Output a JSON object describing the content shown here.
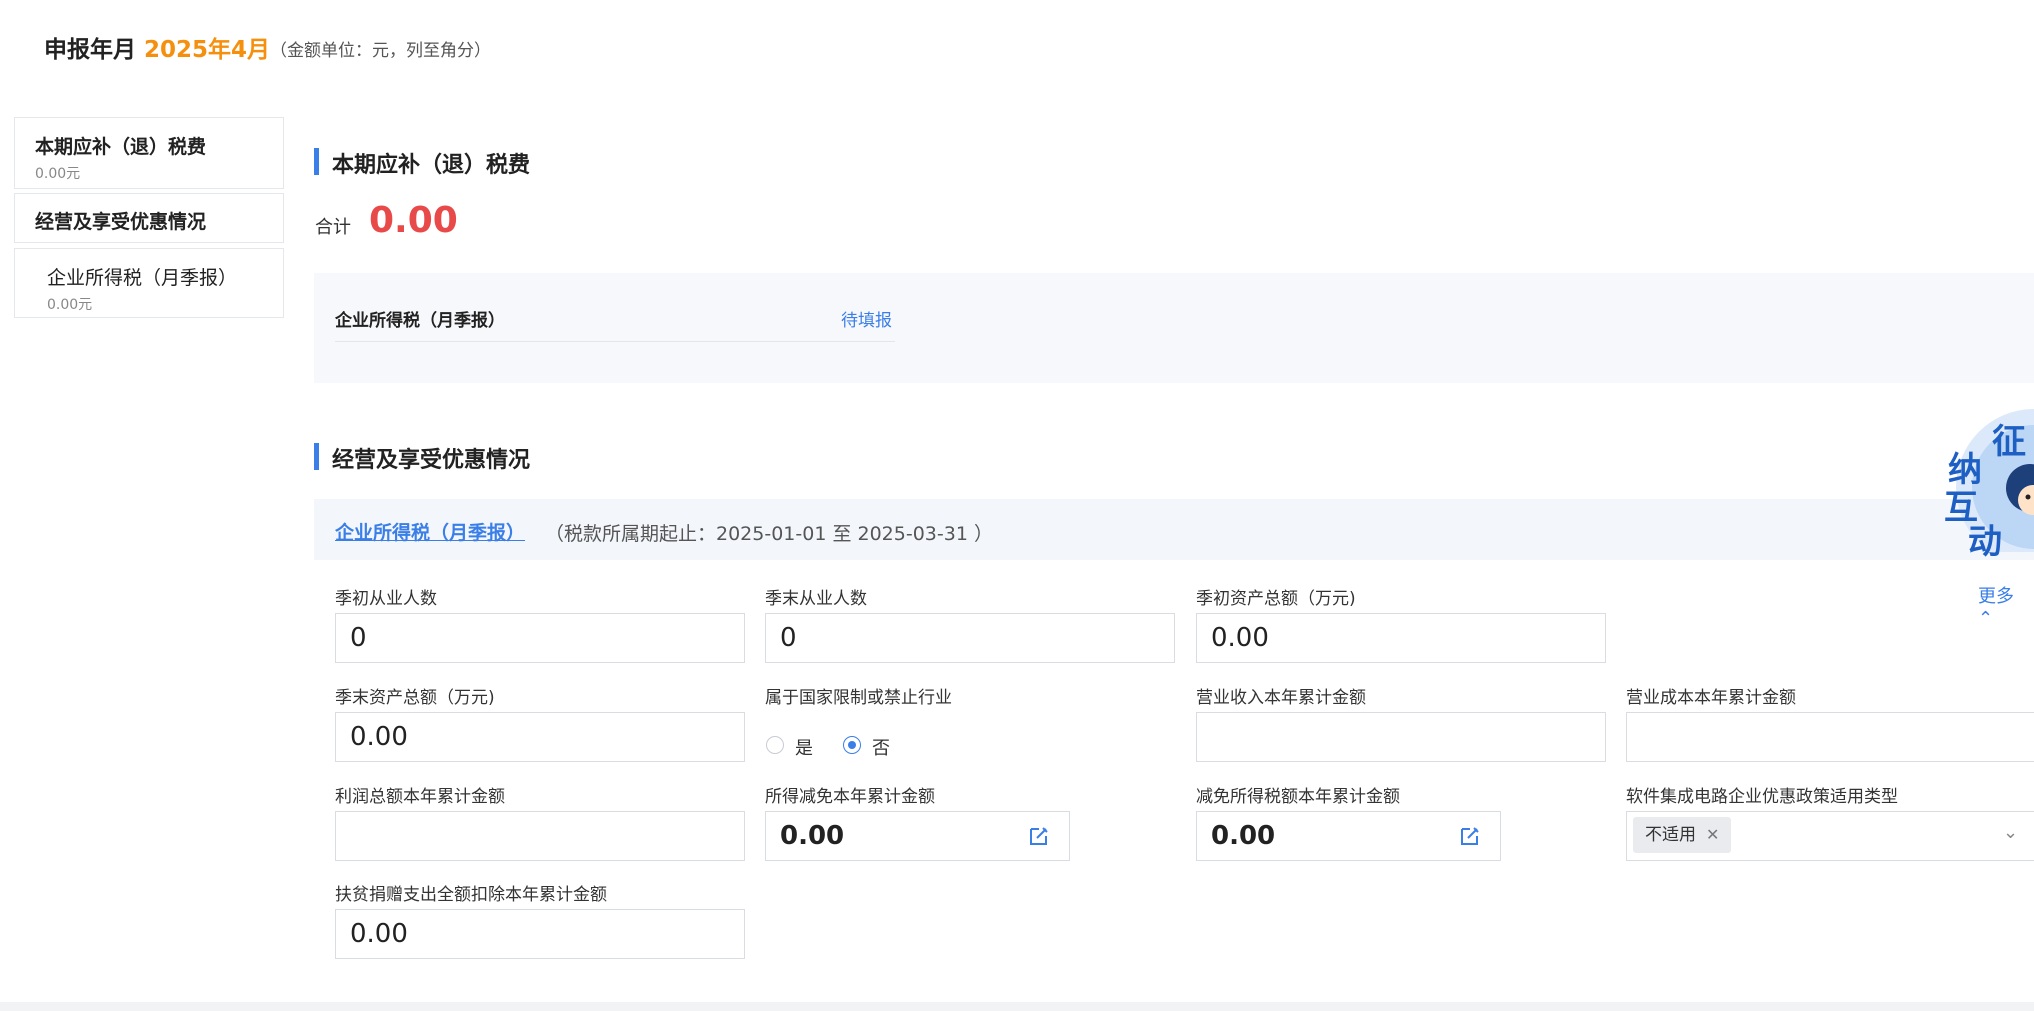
{
  "header": {
    "label": "申报年月",
    "period": "2025年4月",
    "note": "（金额单位：元，列至角分）"
  },
  "sidebar": {
    "section1": {
      "title": "本期应补（退）税费",
      "amount": "0.00元"
    },
    "section2": {
      "title": "经营及享受优惠情况"
    },
    "item": {
      "title": "企业所得税（月季报）",
      "amount": "0.00元"
    }
  },
  "section1": {
    "title": "本期应补（退）税费",
    "total_label": "合计",
    "total_value": "0.00",
    "tax_name": "企业所得税（月季报）",
    "tax_status": "待填报"
  },
  "section2": {
    "title": "经营及享受优惠情况",
    "tax_link": "企业所得税（月季报）",
    "period_note": "（税款所属期起止：2025-01-01 至 2025-03-31 ）",
    "more": "更多"
  },
  "fields": {
    "f1": {
      "label": "季初从业人数",
      "value": "0"
    },
    "f2": {
      "label": "季末从业人数",
      "value": "0"
    },
    "f3": {
      "label": "季初资产总额（万元)",
      "value": "0.00"
    },
    "f4": {
      "label": "季末资产总额（万元)",
      "value": "0.00"
    },
    "f5": {
      "label": "属于国家限制或禁止行业",
      "yes": "是",
      "no": "否",
      "selected": "否"
    },
    "f6": {
      "label": "营业收入本年累计金额",
      "value": ""
    },
    "f7": {
      "label": "营业成本本年累计金额",
      "value": ""
    },
    "f8": {
      "label": "利润总额本年累计金额",
      "value": ""
    },
    "f9": {
      "label": "所得减免本年累计金额",
      "value": "0.00"
    },
    "f10": {
      "label": "减免所得税额本年累计金额",
      "value": "0.00"
    },
    "f11": {
      "label": "软件集成电路企业优惠政策适用类型",
      "tag": "不适用"
    },
    "f12": {
      "label": "扶贫捐赠支出全额扣除本年累计金额",
      "value": "0.00"
    }
  },
  "mascot": {
    "text": "征纳互动"
  },
  "colors": {
    "accent": "#3a7ee8",
    "period": "#f5900f",
    "total": "#e84a4a"
  }
}
